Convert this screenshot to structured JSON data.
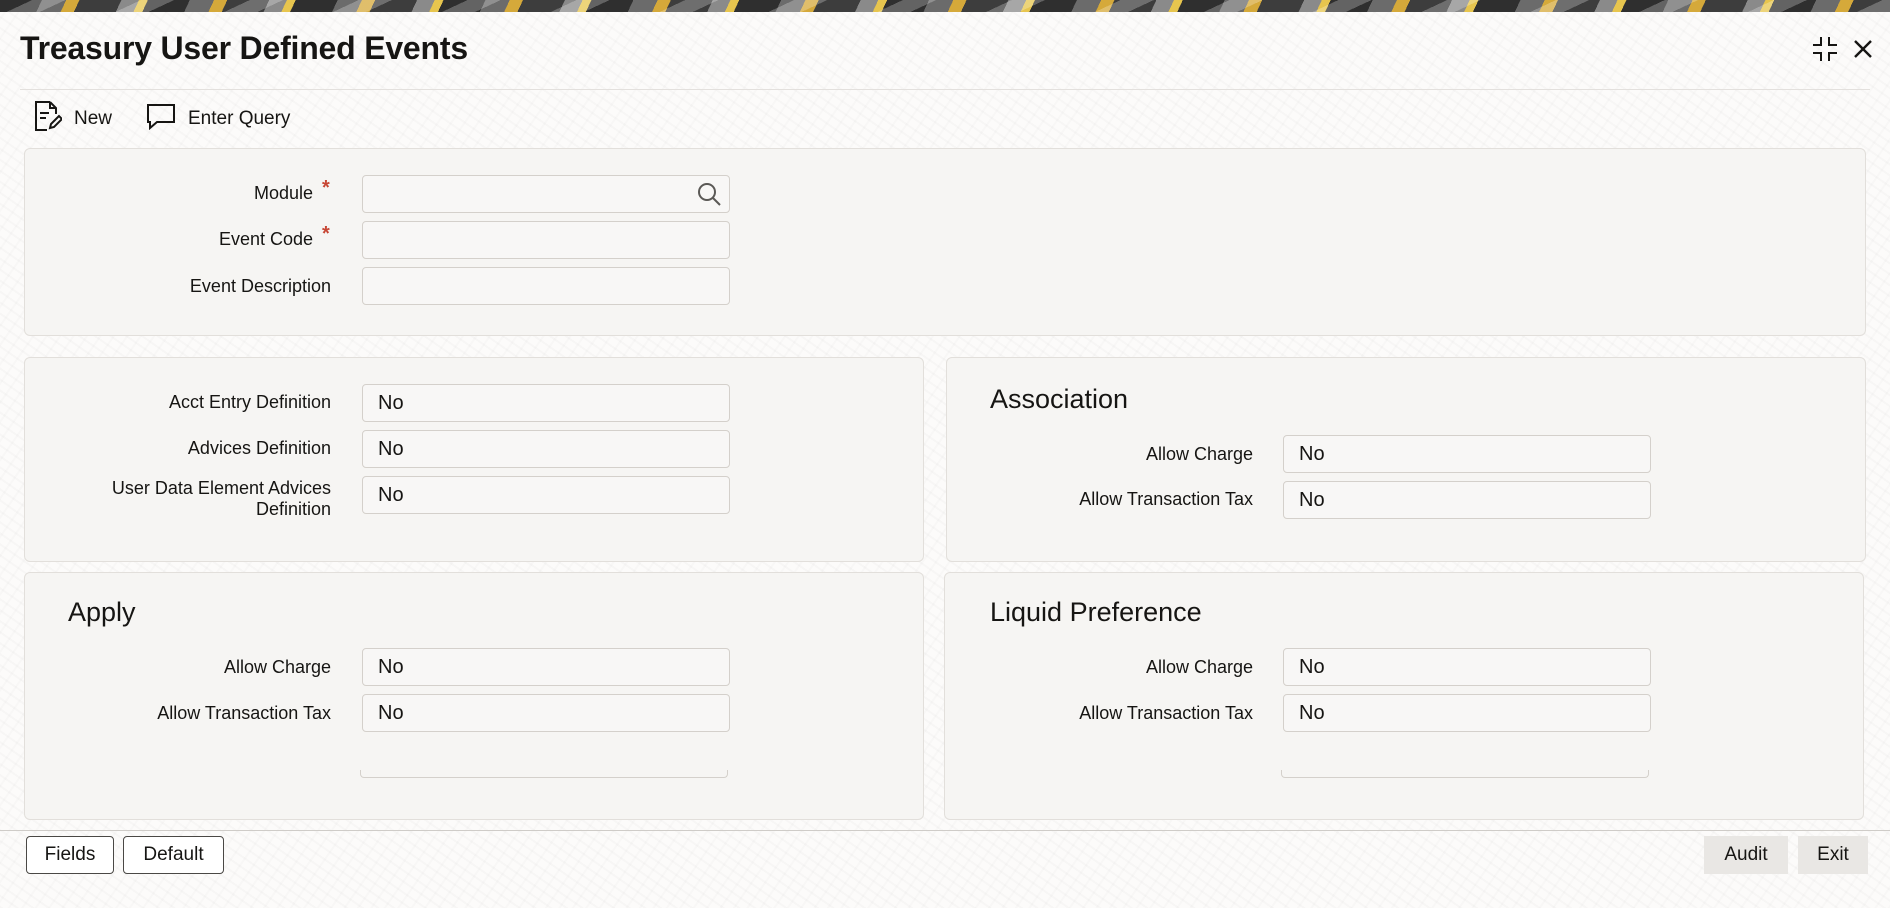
{
  "window": {
    "title": "Treasury User Defined Events",
    "maximize_icon": "collapse-icon",
    "close_icon": "close-icon"
  },
  "toolbar": {
    "new_label": "New",
    "enter_query_label": "Enter Query"
  },
  "header_form": {
    "module_label": "Module",
    "module_value": "",
    "event_code_label": "Event Code",
    "event_code_value": "",
    "event_description_label": "Event Description",
    "event_description_value": "",
    "required_marker": "*"
  },
  "definitions": {
    "acct_entry_label": "Acct Entry Definition",
    "acct_entry_value": "No",
    "advices_label": "Advices Definition",
    "advices_value": "No",
    "ude_advices_label_line1": "User Data Element Advices",
    "ude_advices_label_line2": "Definition",
    "ude_advices_value": "No"
  },
  "association": {
    "title": "Association",
    "allow_charge_label": "Allow Charge",
    "allow_charge_value": "No",
    "allow_tax_label": "Allow Transaction Tax",
    "allow_tax_value": "No"
  },
  "apply": {
    "title": "Apply",
    "allow_charge_label": "Allow Charge",
    "allow_charge_value": "No",
    "allow_tax_label": "Allow Transaction Tax",
    "allow_tax_value": "No"
  },
  "liquid_preference": {
    "title": "Liquid Preference",
    "allow_charge_label": "Allow Charge",
    "allow_charge_value": "No",
    "allow_tax_label": "Allow Transaction Tax",
    "allow_tax_value": "No"
  },
  "footer": {
    "fields_label": "Fields",
    "default_label": "Default",
    "audit_label": "Audit",
    "exit_label": "Exit"
  }
}
